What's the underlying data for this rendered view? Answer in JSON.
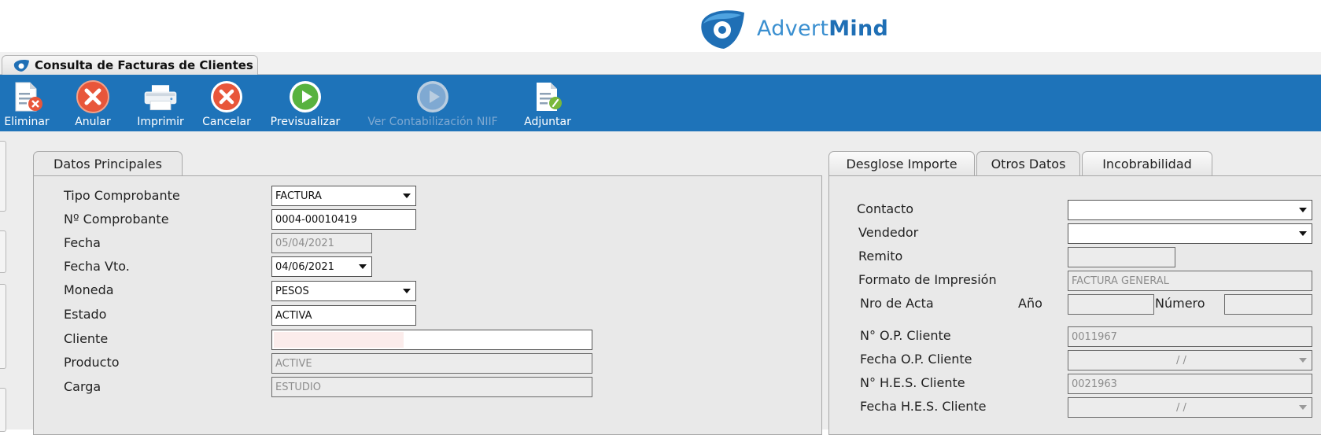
{
  "brand": {
    "name_light": "Advert",
    "name_bold": "Mind"
  },
  "window_tab": {
    "title": "Consulta de Facturas de Clientes"
  },
  "toolbar": {
    "buttons": [
      {
        "label": "Eliminar",
        "icon": "document-delete-icon",
        "enabled": true
      },
      {
        "label": "Anular",
        "icon": "red-x-circle-icon",
        "enabled": true
      },
      {
        "label": "Imprimir",
        "icon": "printer-icon",
        "enabled": true
      },
      {
        "label": "Cancelar",
        "icon": "red-x-circle-icon",
        "enabled": true
      },
      {
        "label": "Previsualizar",
        "icon": "green-play-circle-icon",
        "enabled": true
      },
      {
        "label": "Ver Contabilización NIIF",
        "icon": "play-circle-icon",
        "enabled": false
      },
      {
        "label": "Adjuntar",
        "icon": "document-attach-icon",
        "enabled": true
      }
    ]
  },
  "left_panel": {
    "tab": "Datos Principales",
    "fields": [
      {
        "label": "Tipo Comprobante",
        "value": "FACTURA",
        "type": "select"
      },
      {
        "label": "Nº Comprobante",
        "value": "0004-00010419",
        "type": "text"
      },
      {
        "label": "Fecha",
        "value": "05/04/2021",
        "type": "readonly"
      },
      {
        "label": "Fecha Vto.",
        "value": "04/06/2021",
        "type": "date"
      },
      {
        "label": "Moneda",
        "value": "PESOS",
        "type": "select"
      },
      {
        "label": "Estado",
        "value": "ACTIVA",
        "type": "text"
      },
      {
        "label": "Cliente",
        "value": "",
        "type": "text"
      },
      {
        "label": "Producto",
        "value": "ACTIVE",
        "type": "readonly"
      },
      {
        "label": "Carga",
        "value": "ESTUDIO",
        "type": "readonly"
      }
    ]
  },
  "right_panel": {
    "tabs": [
      "Desglose Importe",
      "Otros Datos",
      "Incobrabilidad"
    ],
    "active_tab": "Otros Datos",
    "fields": {
      "contacto": {
        "label": "Contacto",
        "value": ""
      },
      "vendedor": {
        "label": "Vendedor",
        "value": ""
      },
      "remito": {
        "label": "Remito",
        "value": ""
      },
      "formato": {
        "label": "Formato de Impresión",
        "value": "FACTURA GENERAL"
      },
      "acta": {
        "label": "Nro de Acta",
        "anio_label": "Año",
        "numero_label": "Número",
        "anio": "",
        "numero": ""
      },
      "op_cliente": {
        "label": "N° O.P. Cliente",
        "value": "0011967"
      },
      "fecha_op": {
        "label": "Fecha O.P. Cliente",
        "value": "/ /"
      },
      "hes_cliente": {
        "label": "N° H.E.S. Cliente",
        "value": "0021963"
      },
      "fecha_hes": {
        "label": "Fecha H.E.S. Cliente",
        "value": "/ /"
      }
    }
  },
  "colors": {
    "toolbar_bg": "#1e73b9",
    "brand_blue": "#1f6fb5",
    "workarea_bg": "#ededed"
  }
}
